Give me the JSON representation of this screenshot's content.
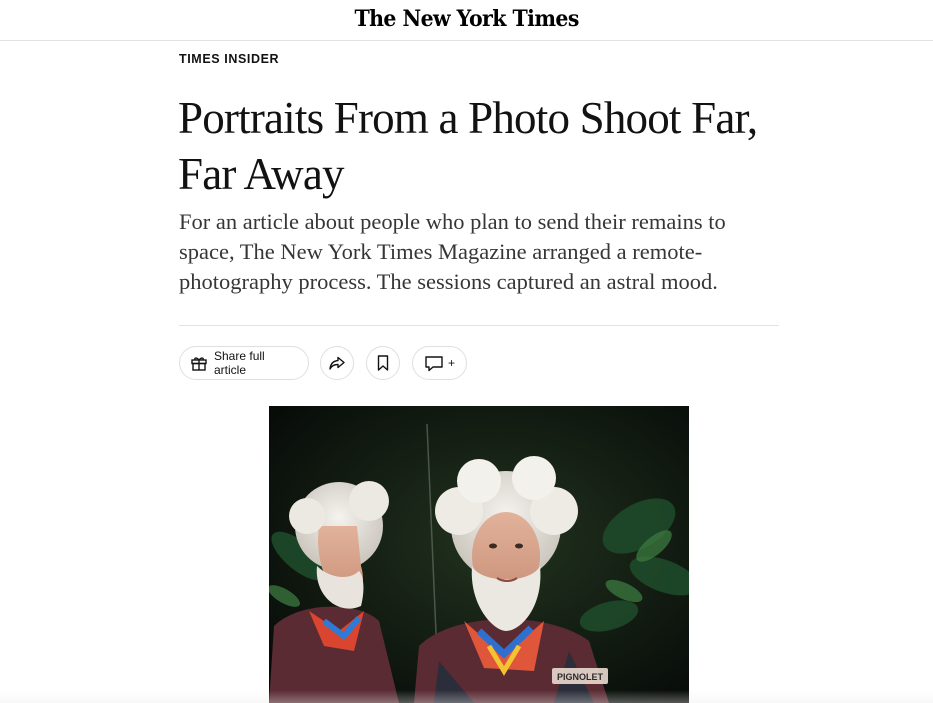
{
  "masthead": {
    "logo_text": "The New York Times"
  },
  "article": {
    "kicker": "TIMES INSIDER",
    "headline": "Portraits From a Photo Shoot Far, Far Away",
    "summary": "For an article about people who plan to send their remains to space, The New York Times Magazine arranged a remote-photography process. The sessions captured an astral mood."
  },
  "share_bar": {
    "share_label": "Share full article",
    "comment_plus": "+",
    "icons": {
      "gift": "gift-icon",
      "forward": "forward-arrow-icon",
      "save": "bookmark-icon",
      "comment": "comment-bubble-icon"
    }
  },
  "photo": {
    "patch_text": "PIGNOLET"
  },
  "colors": {
    "text": "#121212",
    "summary": "#363636",
    "divider": "#e2e2e2",
    "pill_border": "#dfdfdf"
  }
}
